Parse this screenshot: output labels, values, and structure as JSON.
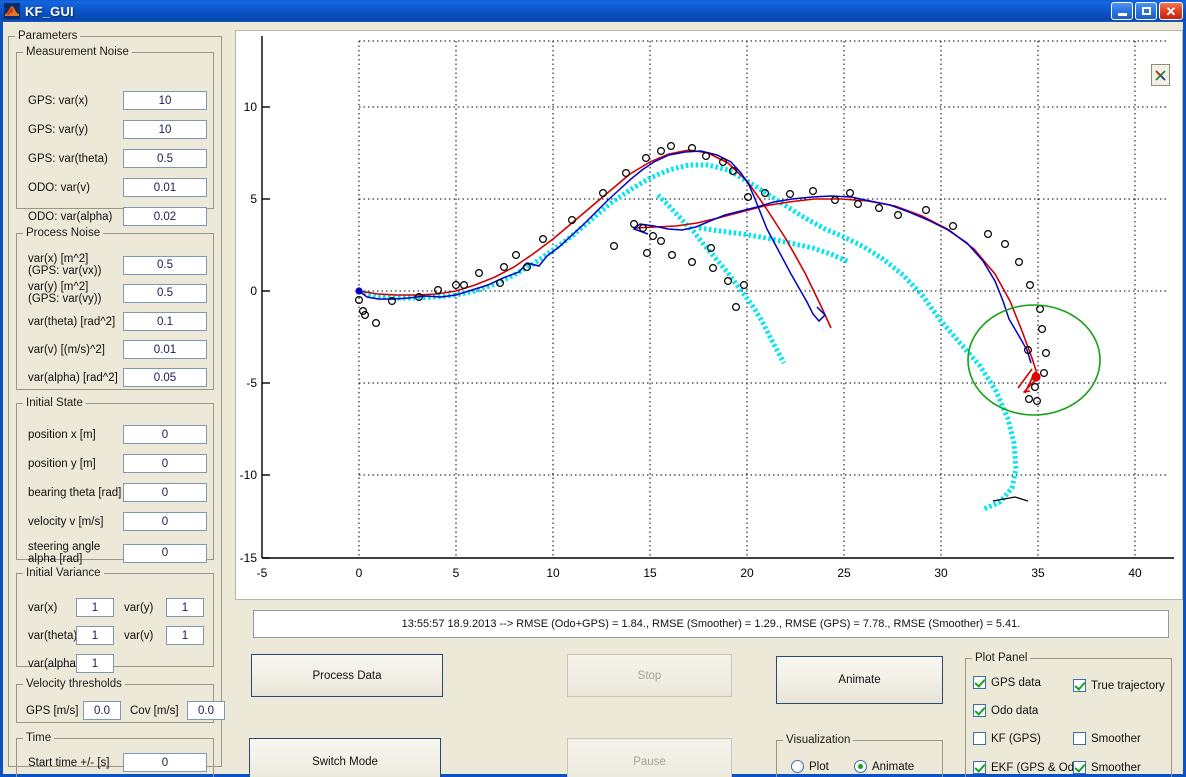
{
  "window": {
    "title": "KF_GUI",
    "icon": "matlab-logo-icon",
    "minimize_label": "_",
    "maximize_label": "□",
    "close_label": "✕"
  },
  "sidebar": {
    "parameters_legend": "Parameters",
    "measurement_noise": {
      "legend": "Measurement Noise",
      "fields": [
        {
          "label": "GPS: var(x)",
          "value": "10"
        },
        {
          "label": "GPS: var(y)",
          "value": "10"
        },
        {
          "label": "GPS: var(theta)",
          "value": "0.5"
        },
        {
          "label": "ODO: var(v)",
          "value": "0.01"
        },
        {
          "label": "ODO: var(alpha)",
          "value": "0.02"
        }
      ]
    },
    "process_noise": {
      "legend": "Process Noise",
      "fields": [
        {
          "label": "var(x)  [m^2]\n(GPS: var(vx))",
          "value": "0.5"
        },
        {
          "label": "var(y)  [m^2]\n(GPS: var(vy))",
          "value": "0.5"
        },
        {
          "label": "var(theta) [rad^2]",
          "value": "0.1"
        },
        {
          "label": "var(v) [(m/s)^2]",
          "value": "0.01"
        },
        {
          "label": "var(alpha) [rad^2]",
          "value": "0.05"
        }
      ]
    },
    "initial_state": {
      "legend": "Initial State",
      "fields": [
        {
          "label": "position x [m]",
          "value": "0"
        },
        {
          "label": "position y [m]",
          "value": "0"
        },
        {
          "label": "bearing theta [rad]",
          "value": "0"
        },
        {
          "label": "velocity v [m/s]",
          "value": "0"
        },
        {
          "label": "steering angle\nalpha [rad]",
          "value": "0"
        }
      ]
    },
    "initial_variance": {
      "legend": "Initial Variance",
      "fields": [
        {
          "label": "var(x)",
          "value": "1"
        },
        {
          "label": "var(y)",
          "value": "1"
        },
        {
          "label": "var(theta)",
          "value": "1"
        },
        {
          "label": "var(v)",
          "value": "1"
        },
        {
          "label": "var(alpha)",
          "value": "1"
        }
      ]
    },
    "velocity_thresholds": {
      "legend": "Velocity thresholds",
      "fields": [
        {
          "label": "GPS [m/s]",
          "value": "0.0"
        },
        {
          "label": "Cov [m/s]",
          "value": "0.0"
        }
      ]
    },
    "time": {
      "legend": "Time",
      "fields": [
        {
          "label": "Start time +/- [s]",
          "value": "0"
        }
      ]
    }
  },
  "plot": {
    "close_button_label": "X",
    "close_button_icon": "matlab-x-icon"
  },
  "status": {
    "text": "13:55:57 18.9.2013 --> RMSE (Odo+GPS) = 1.84., RMSE (Smoother) = 1.29., RMSE (GPS) = 7.78., RMSE (Smoother) = 5.41."
  },
  "buttons": {
    "process_data": "Process Data",
    "switch_mode": "Switch Mode",
    "stop": "Stop",
    "pause": "Pause",
    "animate": "Animate"
  },
  "visualization": {
    "legend": "Visualization",
    "options": [
      {
        "label": "Plot",
        "selected": false
      },
      {
        "label": "Animate",
        "selected": true
      }
    ]
  },
  "plot_panel": {
    "legend": "Plot Panel",
    "items": [
      {
        "label": "GPS data",
        "checked": true
      },
      {
        "label": "True trajectory",
        "checked": true
      },
      {
        "label": "Odo data",
        "checked": true
      },
      {
        "label": "KF (GPS)",
        "checked": false
      },
      {
        "label": "Smoother",
        "checked": false
      },
      {
        "label": "EKF (GPS & Odo)",
        "checked": true
      },
      {
        "label": "Smoother",
        "checked": true
      }
    ]
  },
  "chart_data": {
    "type": "line",
    "title": "",
    "xlabel": "",
    "ylabel": "",
    "xlim": [
      -5,
      42
    ],
    "ylim": [
      -15,
      13
    ],
    "xticks": [
      -5,
      0,
      5,
      10,
      15,
      20,
      25,
      30,
      35,
      40
    ],
    "yticks": [
      10,
      5,
      0,
      -5,
      -10,
      -15
    ],
    "grid": true,
    "grid_style": "dotted",
    "legend_position": "none",
    "colors": {
      "ekf": "#0000c8",
      "smoother": "#d00000",
      "odo": "#00e5ef",
      "gps_marker": "#000000",
      "covariance_ellipse": "#14a014",
      "current_position": "#e00000",
      "start_position": "#0000c8"
    },
    "series": [
      {
        "name": "EKF (GPS & Odo)",
        "color": "#0000c8",
        "style": "zigzag-line",
        "points": [
          [
            0,
            0
          ],
          [
            0.4,
            -0.35
          ],
          [
            1.0,
            -0.45
          ],
          [
            1.8,
            -0.42
          ],
          [
            2.6,
            -0.38
          ],
          [
            3.4,
            -0.3
          ],
          [
            4.2,
            -0.32
          ],
          [
            5.0,
            -0.2
          ],
          [
            5.8,
            0.05
          ],
          [
            6.6,
            0.35
          ],
          [
            7.4,
            0.7
          ],
          [
            8.2,
            1.05
          ],
          [
            8.6,
            1.5
          ],
          [
            9.2,
            1.35
          ],
          [
            9.6,
            1.9
          ],
          [
            10.2,
            2.4
          ],
          [
            10.8,
            3.0
          ],
          [
            11.4,
            3.6
          ],
          [
            12.0,
            4.25
          ],
          [
            12.6,
            4.9
          ],
          [
            13.2,
            5.5
          ],
          [
            13.8,
            6.1
          ],
          [
            14.4,
            6.6
          ],
          [
            15.0,
            7.05
          ],
          [
            15.8,
            7.45
          ],
          [
            16.6,
            7.65
          ],
          [
            17.4,
            7.7
          ],
          [
            18.2,
            7.5
          ],
          [
            18.9,
            7.1
          ],
          [
            19.4,
            6.5
          ],
          [
            19.8,
            5.85
          ],
          [
            20.1,
            5.1
          ],
          [
            20.4,
            4.3
          ],
          [
            20.7,
            3.5
          ],
          [
            21.0,
            2.7
          ],
          [
            21.4,
            1.9
          ],
          [
            21.8,
            1.1
          ],
          [
            22.2,
            0.3
          ],
          [
            22.6,
            -0.45
          ],
          [
            23.0,
            -1.2
          ],
          [
            23.3,
            -1.85
          ],
          [
            23.6,
            -2.2
          ],
          [
            23.9,
            -1.9
          ],
          [
            23.5,
            -1.5
          ]
        ]
      },
      {
        "name": "EKF branch 2",
        "color": "#0000c8",
        "style": "zigzag-line",
        "points": [
          [
            14.9,
            3.1
          ],
          [
            14.2,
            3.35
          ],
          [
            14.5,
            3.6
          ],
          [
            15.2,
            3.5
          ],
          [
            15.9,
            3.35
          ],
          [
            16.6,
            3.3
          ],
          [
            17.3,
            3.45
          ],
          [
            18.0,
            3.75
          ],
          [
            18.8,
            4.05
          ],
          [
            19.6,
            4.3
          ],
          [
            20.4,
            4.5
          ],
          [
            21.3,
            4.75
          ],
          [
            22.2,
            4.9
          ],
          [
            23.2,
            5.0
          ],
          [
            24.2,
            5.05
          ],
          [
            25.2,
            5.0
          ],
          [
            26.2,
            4.85
          ],
          [
            27.2,
            4.6
          ],
          [
            28.2,
            4.25
          ],
          [
            29.2,
            3.8
          ],
          [
            30.2,
            3.25
          ],
          [
            31.2,
            2.55
          ],
          [
            32.2,
            1.7
          ],
          [
            33.0,
            0.7
          ],
          [
            33.6,
            -0.4
          ],
          [
            34.0,
            -1.5
          ],
          [
            34.3,
            -2.5
          ],
          [
            34.8,
            -3.4
          ],
          [
            35.2,
            -4.2
          ],
          [
            35.4,
            -4.9
          ]
        ]
      },
      {
        "name": "Smoother",
        "color": "#d00000",
        "style": "smooth-line",
        "points": [
          [
            0,
            0
          ],
          [
            1.0,
            -0.15
          ],
          [
            2.0,
            -0.2
          ],
          [
            3.0,
            -0.2
          ],
          [
            4.0,
            -0.15
          ],
          [
            5.0,
            0.0
          ],
          [
            6.0,
            0.3
          ],
          [
            7.0,
            0.75
          ],
          [
            8.0,
            1.3
          ],
          [
            9.0,
            2.0
          ],
          [
            10.0,
            2.8
          ],
          [
            11.0,
            3.7
          ],
          [
            12.0,
            4.6
          ],
          [
            13.0,
            5.5
          ],
          [
            14.0,
            6.35
          ],
          [
            15.0,
            7.0
          ],
          [
            16.0,
            7.45
          ],
          [
            17.0,
            7.65
          ],
          [
            18.0,
            7.5
          ],
          [
            19.0,
            6.95
          ],
          [
            20.0,
            5.95
          ],
          [
            21.0,
            4.5
          ],
          [
            22.0,
            2.8
          ],
          [
            23.0,
            1.0
          ],
          [
            23.8,
            -0.8
          ],
          [
            24.3,
            -2.0
          ]
        ]
      },
      {
        "name": "Smoother branch 2",
        "color": "#d00000",
        "style": "smooth-line",
        "points": [
          [
            14.3,
            3.4
          ],
          [
            15.3,
            3.45
          ],
          [
            16.4,
            3.5
          ],
          [
            17.5,
            3.65
          ],
          [
            18.6,
            3.95
          ],
          [
            19.8,
            4.25
          ],
          [
            21.0,
            4.55
          ],
          [
            22.3,
            4.8
          ],
          [
            23.6,
            4.95
          ],
          [
            25.0,
            5.0
          ],
          [
            26.4,
            4.9
          ],
          [
            27.8,
            4.6
          ],
          [
            29.2,
            4.1
          ],
          [
            30.6,
            3.35
          ],
          [
            31.9,
            2.35
          ],
          [
            33.0,
            1.0
          ],
          [
            33.8,
            -0.5
          ],
          [
            34.4,
            -2.1
          ],
          [
            34.9,
            -3.6
          ],
          [
            35.2,
            -4.6
          ],
          [
            35.3,
            -5.1
          ],
          [
            34.6,
            -5.9
          ],
          [
            34.9,
            -5.85
          ]
        ]
      },
      {
        "name": "Odo data (true)",
        "color": "#00e5ef",
        "style": "thick-dotted-line",
        "points": [
          [
            0,
            0
          ],
          [
            1.0,
            -0.3
          ],
          [
            2.0,
            -0.35
          ],
          [
            3.0,
            -0.35
          ],
          [
            4.0,
            -0.3
          ],
          [
            5.0,
            -0.2
          ],
          [
            6.0,
            0.0
          ],
          [
            7.0,
            0.35
          ],
          [
            8.0,
            0.85
          ],
          [
            9.0,
            1.45
          ],
          [
            10.0,
            2.2
          ],
          [
            11.0,
            3.0
          ],
          [
            12.0,
            3.9
          ],
          [
            13.0,
            4.75
          ],
          [
            14.0,
            5.5
          ],
          [
            15.0,
            6.15
          ],
          [
            16.0,
            6.6
          ],
          [
            17.0,
            6.85
          ],
          [
            18.0,
            6.85
          ],
          [
            19.0,
            6.6
          ],
          [
            20.0,
            6.1
          ],
          [
            21.0,
            5.45
          ],
          [
            22.0,
            4.75
          ],
          [
            23.0,
            4.1
          ],
          [
            24.0,
            3.5
          ],
          [
            25.0,
            2.95
          ],
          [
            26.0,
            2.4
          ],
          [
            27.0,
            1.8
          ],
          [
            28.0,
            1.15
          ],
          [
            29.0,
            0.35
          ],
          [
            30.0,
            -0.55
          ],
          [
            31.0,
            -1.6
          ],
          [
            32.0,
            -2.8
          ],
          [
            32.8,
            -4.1
          ],
          [
            33.4,
            -5.5
          ],
          [
            33.7,
            -7.0
          ],
          [
            33.8,
            -8.3
          ],
          [
            33.6,
            -9.3
          ],
          [
            33.0,
            -10.0
          ],
          [
            32.2,
            -10.35
          ]
        ]
      },
      {
        "name": "Odo branch 2",
        "color": "#00e5ef",
        "style": "thick-dotted-line",
        "points": [
          [
            15.4,
            5.2
          ],
          [
            16.0,
            4.6
          ],
          [
            16.6,
            3.95
          ],
          [
            17.2,
            3.3
          ],
          [
            17.8,
            2.6
          ],
          [
            18.4,
            1.85
          ],
          [
            19.0,
            1.1
          ],
          [
            19.6,
            0.3
          ],
          [
            20.2,
            -0.5
          ],
          [
            20.7,
            -1.35
          ],
          [
            21.1,
            -2.2
          ],
          [
            21.5,
            -3.0
          ],
          [
            21.8,
            -3.6
          ]
        ]
      },
      {
        "name": "Odo branch 3",
        "color": "#00e5ef",
        "style": "thick-dotted-line",
        "points": [
          [
            17.5,
            3.45
          ],
          [
            18.6,
            3.3
          ],
          [
            19.8,
            3.15
          ],
          [
            21.0,
            2.95
          ],
          [
            22.2,
            2.7
          ],
          [
            23.4,
            2.4
          ],
          [
            24.4,
            2.05
          ],
          [
            25.2,
            1.7
          ]
        ]
      }
    ],
    "gps_markers": [
      [
        0.0,
        -0.5
      ],
      [
        0.2,
        -1.1
      ],
      [
        0.3,
        -1.3
      ],
      [
        0.9,
        -1.75
      ],
      [
        1.7,
        -0.55
      ],
      [
        3.1,
        -0.35
      ],
      [
        4.1,
        0.05
      ],
      [
        5.0,
        0.35
      ],
      [
        5.4,
        0.35
      ],
      [
        6.2,
        1.0
      ],
      [
        7.3,
        0.45
      ],
      [
        7.5,
        1.3
      ],
      [
        8.1,
        1.95
      ],
      [
        8.7,
        1.3
      ],
      [
        9.5,
        2.8
      ],
      [
        11.0,
        3.85
      ],
      [
        12.6,
        5.3
      ],
      [
        13.8,
        6.4
      ],
      [
        14.8,
        7.2
      ],
      [
        15.6,
        7.6
      ],
      [
        16.1,
        7.85
      ],
      [
        17.2,
        7.75
      ],
      [
        17.9,
        7.35
      ],
      [
        18.8,
        7.0
      ],
      [
        19.3,
        6.5
      ],
      [
        14.2,
        3.65
      ],
      [
        14.7,
        3.45
      ],
      [
        15.2,
        3.0
      ],
      [
        15.6,
        2.75
      ],
      [
        14.9,
        2.1
      ],
      [
        13.2,
        2.45
      ],
      [
        16.2,
        1.95
      ],
      [
        17.2,
        1.55
      ],
      [
        18.3,
        1.25
      ],
      [
        19.1,
        0.55
      ],
      [
        19.9,
        0.3
      ],
      [
        19.5,
        -0.85
      ],
      [
        18.2,
        2.35
      ],
      [
        20.1,
        5.1
      ],
      [
        21.0,
        5.35
      ],
      [
        22.3,
        5.3
      ],
      [
        23.5,
        5.45
      ],
      [
        24.6,
        4.95
      ],
      [
        25.4,
        5.35
      ],
      [
        25.8,
        4.75
      ],
      [
        26.9,
        4.55
      ],
      [
        27.9,
        4.15
      ],
      [
        29.3,
        4.4
      ],
      [
        30.7,
        3.55
      ],
      [
        32.5,
        3.1
      ],
      [
        33.4,
        2.55
      ],
      [
        34.1,
        1.6
      ],
      [
        34.7,
        0.3
      ],
      [
        35.2,
        -1.0
      ],
      [
        35.3,
        -2.1
      ],
      [
        34.6,
        -3.2
      ],
      [
        35.5,
        -3.4
      ],
      [
        35.4,
        -4.45
      ],
      [
        34.9,
        -5.2
      ],
      [
        34.6,
        -5.85
      ],
      [
        35.0,
        -5.95
      ]
    ],
    "annotations": {
      "covariance_ellipse": {
        "cx": 35.0,
        "cy": -4.9,
        "rx": 3.2,
        "ry": 2.4
      },
      "current_position": {
        "x": 35.2,
        "y": -5.0
      },
      "start_position": {
        "x": 0.0,
        "y": 0.0
      }
    }
  }
}
